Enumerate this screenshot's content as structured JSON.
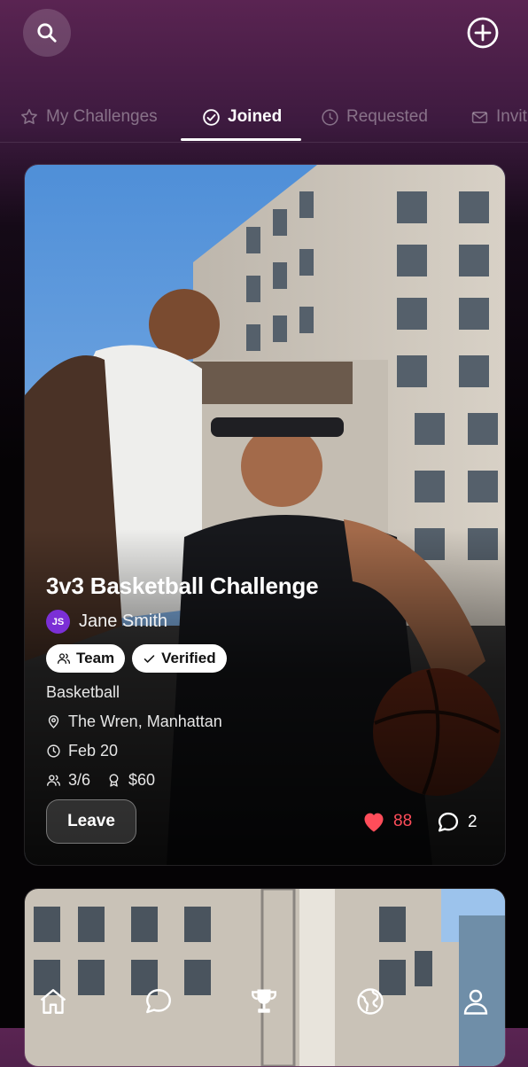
{
  "header": {
    "tabs": [
      {
        "label": "My Challenges",
        "icon": "star-icon",
        "active": false
      },
      {
        "label": "Joined",
        "icon": "check-circle-icon",
        "active": true
      },
      {
        "label": "Requested",
        "icon": "clock-icon",
        "active": false
      },
      {
        "label": "Invit",
        "icon": "mail-icon",
        "active": false
      }
    ]
  },
  "card": {
    "title": "3v3 Basketball Challenge",
    "organizer": {
      "initials": "JS",
      "name": "Jane Smith",
      "avatar_color": "#7b2fd6"
    },
    "badges": [
      {
        "label": "Team",
        "icon": "users-icon"
      },
      {
        "label": "Verified",
        "icon": "check-icon"
      }
    ],
    "sport": "Basketball",
    "location": "The Wren, Manhattan",
    "date": "Feb 20",
    "participants": "3/6",
    "prize": "$60",
    "leave_label": "Leave",
    "likes": "88",
    "comments": "2",
    "like_color": "#ff4d5a"
  },
  "bottom_nav": [
    {
      "icon": "home-icon",
      "active": false
    },
    {
      "icon": "chat-icon",
      "active": false
    },
    {
      "icon": "trophy-icon",
      "active": true
    },
    {
      "icon": "globe-icon",
      "active": false
    },
    {
      "icon": "profile-icon",
      "active": false
    }
  ]
}
